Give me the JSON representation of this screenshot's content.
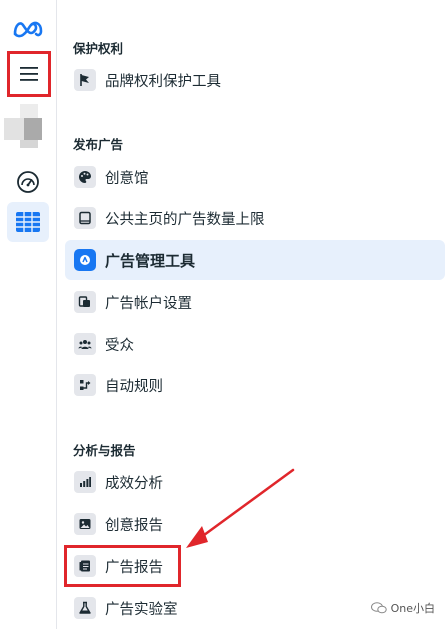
{
  "rail": {
    "logo_icon": "meta-logo-icon",
    "menu_icon": "hamburger-menu-icon",
    "gauge_icon": "gauge-icon",
    "table_icon": "table-grid-icon"
  },
  "sections": [
    {
      "title": "保护权利",
      "items": [
        {
          "label": "品牌权利保护工具",
          "icon": "flag-icon"
        }
      ]
    },
    {
      "title": "发布广告",
      "items": [
        {
          "label": "创意馆",
          "icon": "palette-icon"
        },
        {
          "label": "公共主页的广告数量上限",
          "icon": "tablet-icon"
        },
        {
          "label": "广告管理工具",
          "icon": "ads-manager-icon",
          "selected": true
        },
        {
          "label": "广告帐户设置",
          "icon": "account-settings-icon"
        },
        {
          "label": "受众",
          "icon": "audience-icon"
        },
        {
          "label": "自动规则",
          "icon": "automated-rules-icon"
        }
      ]
    },
    {
      "title": "分析与报告",
      "items": [
        {
          "label": "成效分析",
          "icon": "bar-chart-icon"
        },
        {
          "label": "创意报告",
          "icon": "image-report-icon"
        },
        {
          "label": "广告报告",
          "icon": "ads-report-icon"
        },
        {
          "label": "广告实验室",
          "icon": "flask-icon"
        }
      ]
    }
  ],
  "watermark": {
    "text": "One小白"
  },
  "colors": {
    "highlight": "#e0262b",
    "selected_bg": "#e7f0fc",
    "accent": "#1877f2"
  }
}
